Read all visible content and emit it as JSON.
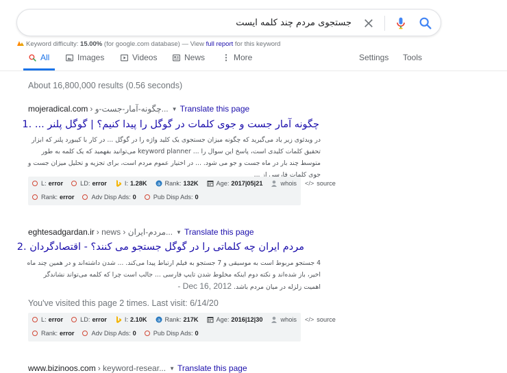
{
  "search": {
    "query": "جستجوی مردم چند کلمه ایست"
  },
  "keyword_difficulty": {
    "label": "Keyword difficulty:",
    "value": "15.00%",
    "source": "(for google.com database) — View",
    "link": "full report",
    "suffix": "for this keyword"
  },
  "tabs": {
    "all": "All",
    "images": "Images",
    "videos": "Videos",
    "news": "News",
    "more": "More",
    "settings": "Settings",
    "tools": "Tools"
  },
  "result_stats": "About 16,800,000 results (0.56 seconds)",
  "results": [
    {
      "domain": "mojeradical.com",
      "path": "› چگونه-آمار-جست-و...",
      "translate": "Translate this page",
      "title": "چگونه آمار جست و جوی کلمات در گوگل را پیدا کنیم؟ | گوگل پلنر ... .1",
      "snippet": "در ویدئوی زیر یاد می‌گیرید که چگونه میزان جستجوی یک کلید واژه را در گوگل ... در کار با کیبورد پلنر که ابزار تحقیق کلمات کلیدی است، پاسخ این سوال را ... keyword planner می‌توانید بفهمید که یک کلمه به طور متوسط چند بار در ماه جست و جو می شود. ... در اختیار عموم مردم است، برای تجزیه و تحلیل میزان جست و جوی کلمات فارسی از ...",
      "metrics": {
        "l": "error",
        "ld": "error",
        "i": "1.28K",
        "rank": "132K",
        "age": "2017|05|21",
        "whois": "whois",
        "source": "source",
        "rank2": "error",
        "adv": "0",
        "pub": "0"
      }
    },
    {
      "domain": "eghtesadgardan.ir",
      "path": "› news › مردم-ایران...",
      "translate": "Translate this page",
      "title": "مردم ایران چه کلماتی را در گوگل جستجو می کنند؟ - اقتصادگردان .2",
      "date": "Dec 16, 2012 -",
      "snippet": "4 جستجو مربوط است به موسیقی و 7 جستجو به فیلم ارتباط پیدا می‌کند. ... شدن داشته‌اند و در همین چند ماه اخیر، باز شده‌اند و نکته دوم اینکه مخلوط شدن تایپ فارسی ... جالب است چرا که کلمه می‌تواند نشاندگر اهمیت زلزله در میان مردم باشد.",
      "visited": "You've visited this page 2 times. Last visit: 6/14/20",
      "metrics": {
        "l": "error",
        "ld": "error",
        "i": "2.10K",
        "rank": "217K",
        "age": "2016|12|30",
        "whois": "whois",
        "source": "source",
        "rank2": "error",
        "adv": "0",
        "pub": "0"
      }
    },
    {
      "domain": "www.bizinoos.com",
      "path": "› keyword-resear...",
      "translate": "Translate this page"
    }
  ],
  "metric_labels": {
    "l": "L:",
    "ld": "LD:",
    "i": "I:",
    "rank": "Rank:",
    "age": "Age:",
    "rank2": "Rank:",
    "adv": "Adv Disp Ads:",
    "pub": "Pub Disp Ads:"
  },
  "colors": {
    "link": "#1a0dab",
    "accent": "#1a73e8",
    "error_ring": "#d14836"
  }
}
